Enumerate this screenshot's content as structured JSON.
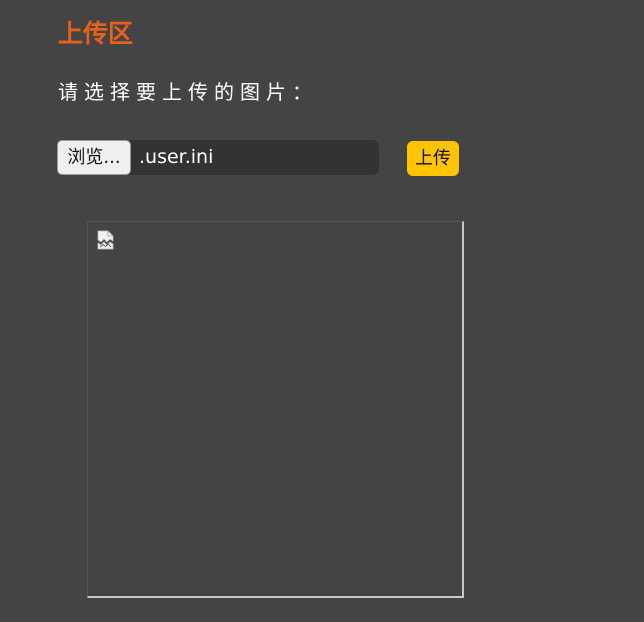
{
  "header": {
    "title": "上传区"
  },
  "form": {
    "prompt": "请选择要上传的图片：",
    "browse_label": "浏览...",
    "selected_file": ".user.ini",
    "upload_label": "上传"
  },
  "preview": {
    "icon": "broken-image-icon"
  },
  "colors": {
    "background": "#444444",
    "title": "#e8601c",
    "upload_button": "#ffc400"
  }
}
